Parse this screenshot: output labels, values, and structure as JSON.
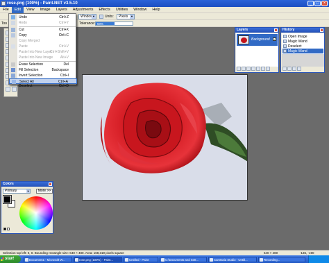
{
  "window": {
    "title": "rose.png (100%) - Paint.NET v3.5.10",
    "minimize": "_",
    "maximize": "□",
    "close": "×"
  },
  "menubar": [
    "File",
    "Edit",
    "View",
    "Image",
    "Layers",
    "Adjustments",
    "Effects",
    "Utilities",
    "Window",
    "Help"
  ],
  "active_menu": "Edit",
  "toolbar": {
    "row1_dropdown_value": "Window",
    "units_label": "Units:",
    "units_value": "Pixels",
    "tolerance_label": "Tolerance:",
    "tolerance_value": "50%",
    "tolerance_fraction": 0.5,
    "tools_label": "Too"
  },
  "edit_menu": {
    "items": [
      {
        "label": "Undo",
        "shortcut": "Ctrl+Z",
        "disabled": false
      },
      {
        "label": "Redo",
        "shortcut": "Ctrl+Y",
        "disabled": true
      },
      {
        "label": "Cut",
        "shortcut": "Ctrl+X",
        "disabled": false
      },
      {
        "label": "Copy",
        "shortcut": "Ctrl+C",
        "disabled": false
      },
      {
        "label": "Copy Merged",
        "shortcut": "",
        "disabled": true
      },
      {
        "label": "Paste",
        "shortcut": "Ctrl+V",
        "disabled": true
      },
      {
        "label": "Paste Into New Layer",
        "shortcut": "Ctrl+Shift+V",
        "disabled": true
      },
      {
        "label": "Paste Into New Image",
        "shortcut": "Alt+V",
        "disabled": true
      },
      {
        "label": "Erase Selection",
        "shortcut": "Del",
        "disabled": false
      },
      {
        "label": "Fill Selection",
        "shortcut": "Backspace",
        "disabled": false
      },
      {
        "label": "Invert Selection",
        "shortcut": "Ctrl+I",
        "disabled": false
      },
      {
        "label": "Select All",
        "shortcut": "Ctrl+A",
        "disabled": false
      },
      {
        "label": "Deselect",
        "shortcut": "Ctrl+D",
        "disabled": false
      }
    ],
    "highlighted": "Select All"
  },
  "layers": {
    "title": "Layers",
    "layer_name": "Background",
    "visible_check": "✓"
  },
  "history": {
    "title": "History",
    "items": [
      "Open Image",
      "Magic Wand",
      "Deselect",
      "Magic Wand"
    ],
    "selected": "Magic Wand"
  },
  "colors": {
    "title": "Colors",
    "mode": "Primary",
    "more_button": "More >>",
    "primary_color": "#000000",
    "secondary_color": "#ffffff"
  },
  "statusbar": {
    "selection": "Selection top left: 0, 0. Bounding rectangle size: 640 × 480. Area: 168,319 pixels square",
    "dimensions": "640 × 480",
    "coords": "-136, -190"
  },
  "taskbar": {
    "start": "start",
    "tasks": [
      "Document1 - Microsoft W...",
      "rose.png (100%) - Paint...",
      "Untitled - Paint",
      "C:\\Documents and Sett...",
      "Camtasia Studio - Untitl...",
      "Recording..."
    ],
    "active_task": "rose.png (100%) - Paint...",
    "clock": ""
  },
  "colors_accent": {
    "titlebar": "#2b63d8",
    "selection": "#316ac5",
    "rose": "#c4141a"
  }
}
